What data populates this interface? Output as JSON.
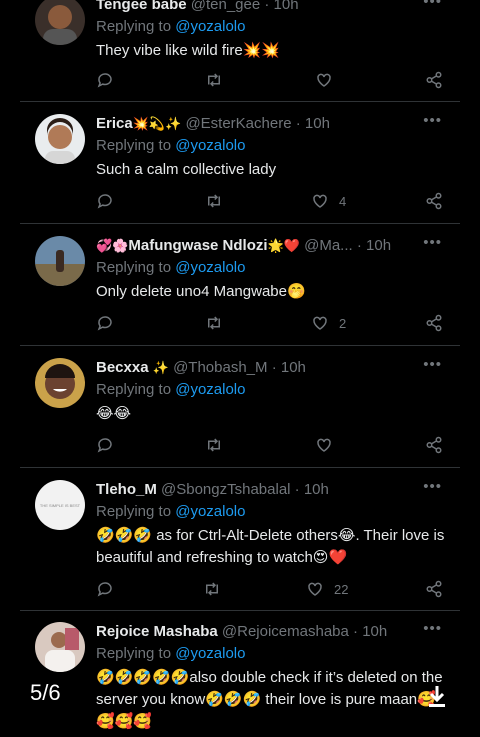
{
  "replying_prefix": "Replying to",
  "tweets": [
    {
      "name": "Tengee babe",
      "name_emoji": "",
      "handle": "@ten_gee",
      "time": "· 10h",
      "mention": "@yozalolo",
      "text": "They vibe like wild fire💥💥",
      "likes": ""
    },
    {
      "name": "Erica",
      "name_emoji": "💥💫✨",
      "handle": "@EsterKachere",
      "time": "· 10h",
      "mention": "@yozalolo",
      "text": "Such a calm collective lady",
      "likes": "4"
    },
    {
      "name": "Mafungwase Ndlozi",
      "name_prefix": "💞🌸",
      "name_emoji": "🌟❤️",
      "handle": "@Ma...",
      "time": "· 10h",
      "mention": "@yozalolo",
      "text": "Only delete uno4 Mangwabe🤭",
      "likes": "2"
    },
    {
      "name": "Becxxa",
      "name_emoji": "✨",
      "handle": "@Thobash_M",
      "time": "· 10h",
      "mention": "@yozalolo",
      "text": "😂😂",
      "likes": ""
    },
    {
      "name": "Tleho_M",
      "name_emoji": "",
      "handle": "@SbongzTshabalal",
      "time": "· 10h",
      "mention": "@yozalolo",
      "text": "🤣🤣🤣 as for Ctrl-Alt-Delete others😂. Their love is beautiful and refreshing to watch😍❤️",
      "likes": "22",
      "avatar_text": "THE SIMPLE IS BEST"
    },
    {
      "name": "Rejoice Mashaba",
      "name_emoji": "",
      "handle": "@Rejoicemashaba",
      "time": "· 10h",
      "mention": "@yozalolo",
      "text": "🤣🤣🤣🤣🤣also double check if it’s deleted on the server you know🤣🤣🤣 their love is pure maan🥰🥰🥰🥰",
      "likes": ""
    }
  ],
  "more_glyph": "•••",
  "media_viewer": {
    "page_indicator": "5/6",
    "download_icon": "download-icon"
  },
  "colors": {
    "background": "#000000",
    "text": "#e7e9ea",
    "muted": "#71767b",
    "link": "#1d9bf0",
    "separator": "#2f3336"
  }
}
